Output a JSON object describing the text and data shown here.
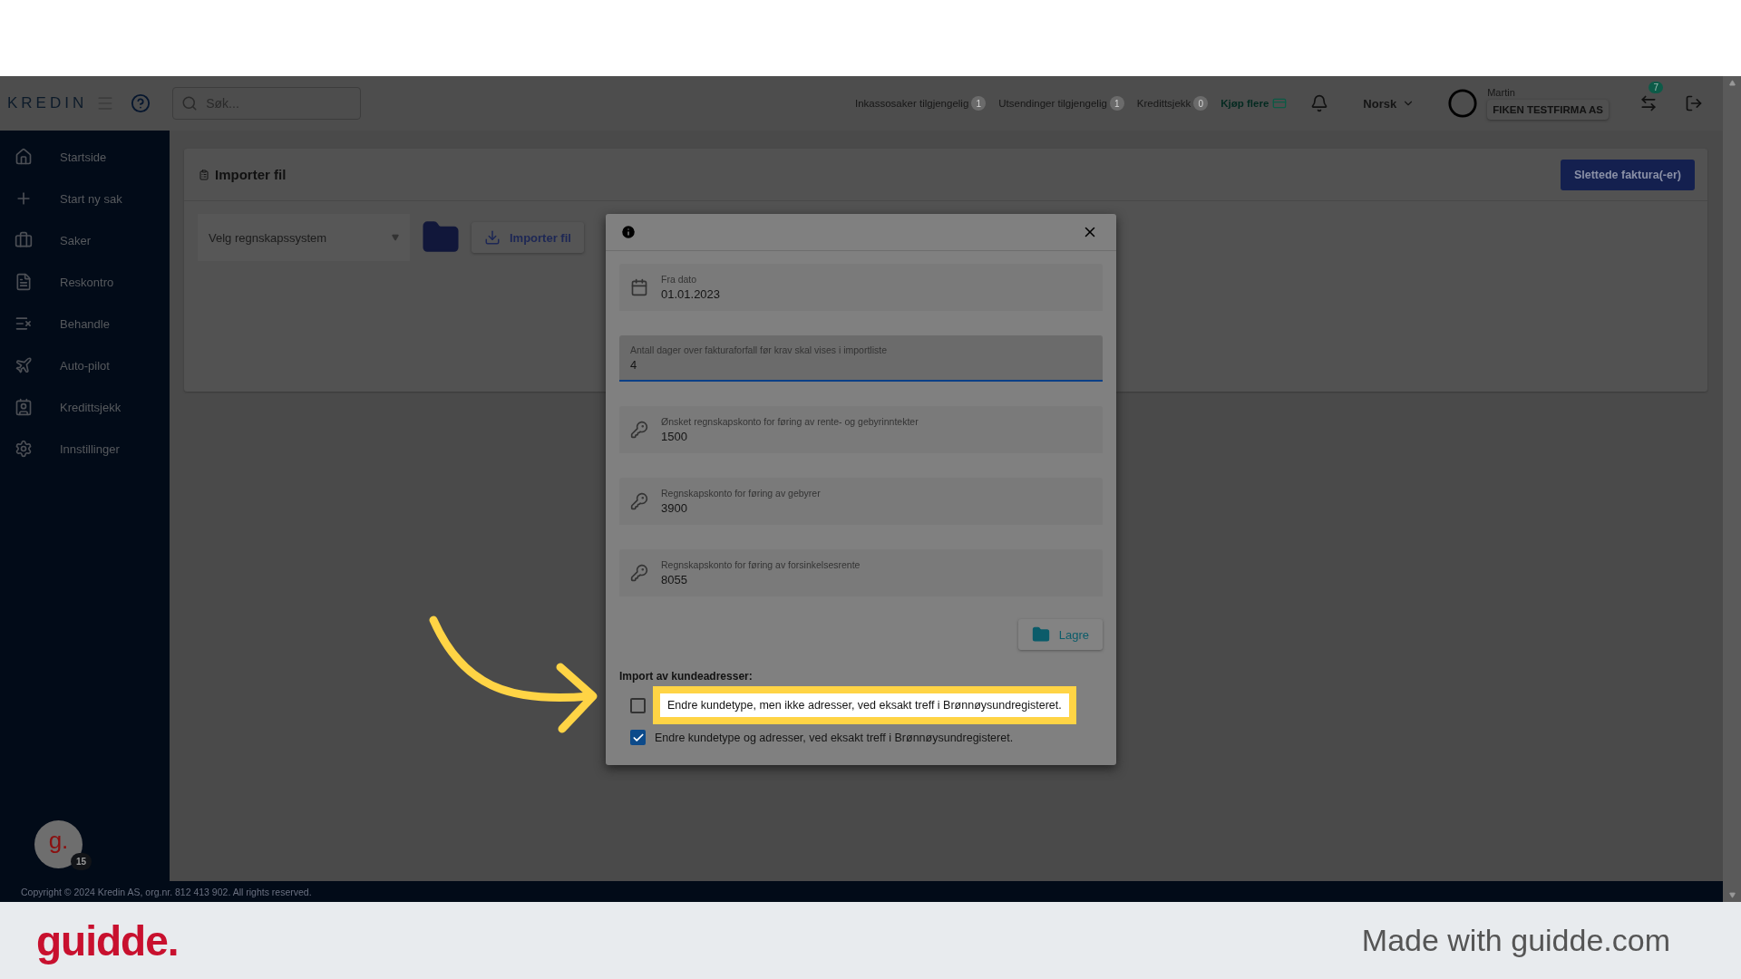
{
  "header": {
    "logo": "KREDIN",
    "search": {
      "placeholder": "Søk..."
    },
    "counters": [
      {
        "label": "Inkassosaker tilgjengelig",
        "count": "1"
      },
      {
        "label": "Utsendinger tilgjengelig",
        "count": "1"
      },
      {
        "label": "Kredittsjekk",
        "count": "0"
      }
    ],
    "buy": "Kjøp flere",
    "language": "Norsk",
    "user": "Martin",
    "company": "FIKEN TESTFIRMA AS",
    "notifications": "7"
  },
  "sidebar": {
    "items": [
      {
        "label": "Startside"
      },
      {
        "label": "Start ny sak"
      },
      {
        "label": "Saker"
      },
      {
        "label": "Reskontro"
      },
      {
        "label": "Behandle"
      },
      {
        "label": "Auto-pilot"
      },
      {
        "label": "Kredittsjekk"
      },
      {
        "label": "Innstillinger"
      }
    ],
    "avatar": "g.",
    "avatar_badge": "15"
  },
  "page": {
    "title": "Importer fil",
    "deleted_button": "Slettede faktura(-er)",
    "select": {
      "placeholder": "Velg regnskapssystem"
    },
    "import_button": "Importer fil"
  },
  "dialog": {
    "fields": [
      {
        "kind": "date",
        "label": "Fra dato",
        "value": "01.01.2023",
        "focused": false
      },
      {
        "kind": "plain",
        "label": "Antall dager over fakturaforfall før krav skal vises i importliste",
        "value": "4",
        "focused": true
      },
      {
        "kind": "key",
        "label": "Ønsket regnskapskonto for føring av rente- og gebyrinntekter",
        "value": "1500",
        "focused": false
      },
      {
        "kind": "key",
        "label": "Regnskapskonto for føring av gebyrer",
        "value": "3900",
        "focused": false
      },
      {
        "kind": "key",
        "label": "Regnskapskonto for føring av forsinkelsesrente",
        "value": "8055",
        "focused": false
      }
    ],
    "save": "Lagre",
    "import_heading": "Import av kundeadresser:",
    "options": [
      {
        "label": "Endre kundetype, men ikke adresser, ved eksakt treff i Brønnøysundregisteret.",
        "checked": false,
        "highlighted": true
      },
      {
        "label": "Endre kundetype og adresser, ved eksakt treff i Brønnøysundregisteret.",
        "checked": true,
        "highlighted": false
      }
    ]
  },
  "copyright": "Copyright © 2024 Kredin AS, org.nr. 812 413 902. All rights reserved.",
  "brand": {
    "logo": "guidde.",
    "tagline": "Made with guidde.com"
  }
}
